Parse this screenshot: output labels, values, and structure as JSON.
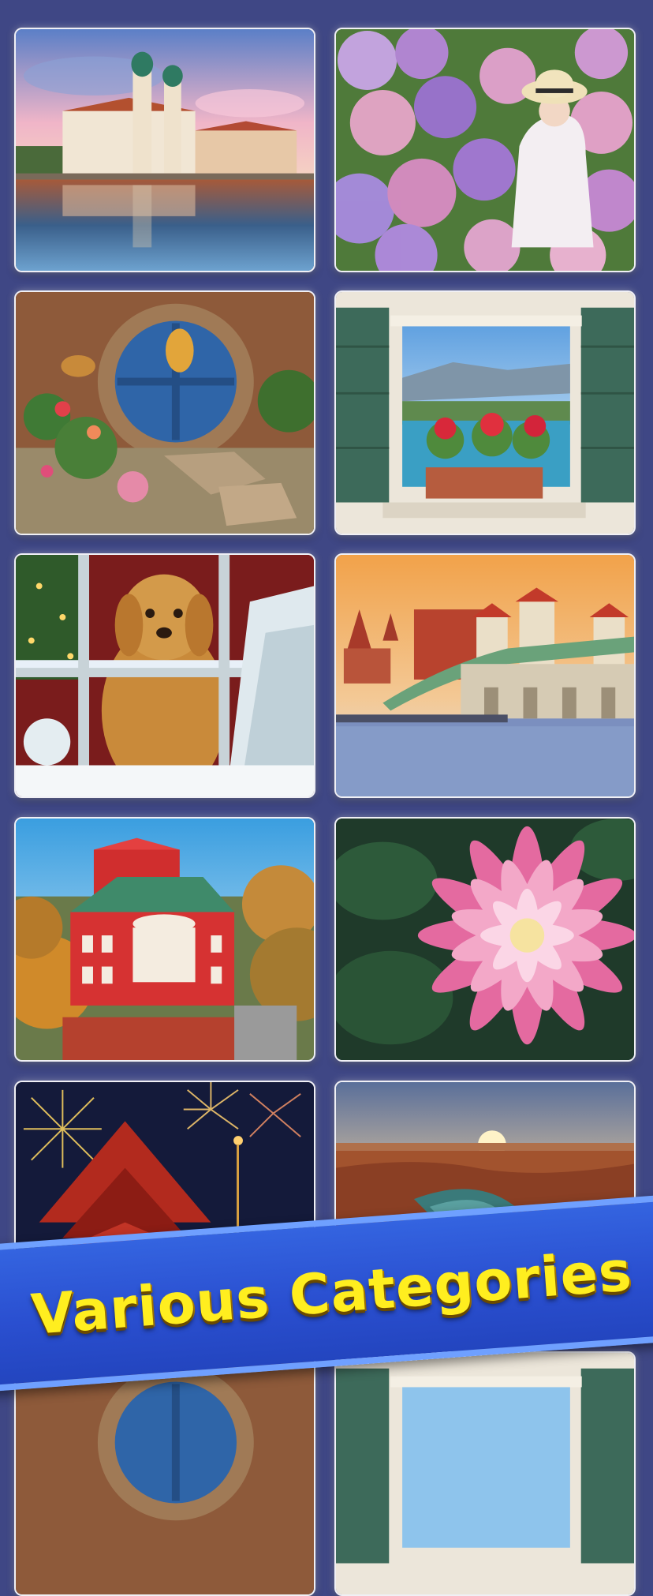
{
  "banner": {
    "title": "Various Categories"
  },
  "colors": {
    "background": "#3f4785",
    "banner": "#2a4fd0",
    "banner_text": "#ffee1f"
  },
  "puzzles": [
    {
      "name": "lakeside-baroque-church"
    },
    {
      "name": "girl-in-hydrangea-garden"
    },
    {
      "name": "round-blue-door-garden"
    },
    {
      "name": "window-with-sea-view"
    },
    {
      "name": "puppy-at-christmas-window"
    },
    {
      "name": "castle-bridge-at-sunset"
    },
    {
      "name": "red-theatre-building-aerial"
    },
    {
      "name": "pink-dahlia-flower"
    },
    {
      "name": "fireworks-over-pagoda"
    },
    {
      "name": "canyon-river-sunset"
    },
    {
      "name": "round-blue-door-garden"
    },
    {
      "name": "window-with-sea-view"
    }
  ]
}
